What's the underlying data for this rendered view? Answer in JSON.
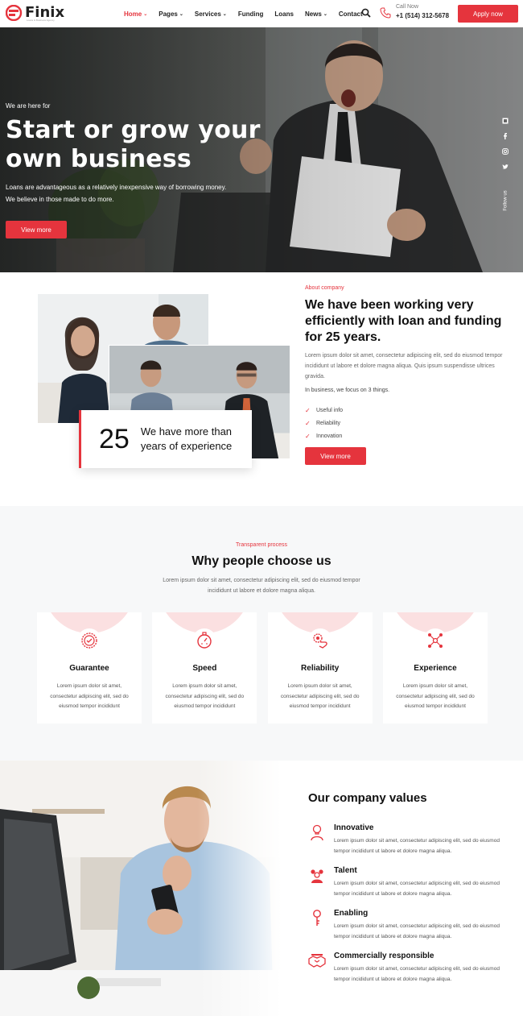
{
  "colors": {
    "accent": "#e5343d",
    "accent_soft": "#fbe0e1",
    "dark_text": "#111111",
    "muted_text": "#666666"
  },
  "header": {
    "logo_text": "Finix",
    "logo_tagline": "Loans & Business Agency",
    "nav": [
      {
        "label": "Home",
        "has_caret": true,
        "active": true
      },
      {
        "label": "Pages",
        "has_caret": true,
        "active": false
      },
      {
        "label": "Services",
        "has_caret": true,
        "active": false
      },
      {
        "label": "Funding",
        "has_caret": false,
        "active": false
      },
      {
        "label": "Loans",
        "has_caret": false,
        "active": false
      },
      {
        "label": "News",
        "has_caret": true,
        "active": false
      },
      {
        "label": "Contact",
        "has_caret": false,
        "active": false
      }
    ],
    "caret_glyph": "⌄",
    "search_icon": "search-icon",
    "call_label": "Call Now",
    "call_number": "+1 (514) 312-5678",
    "apply_label": "Apply now"
  },
  "hero": {
    "kicker": "We are here for",
    "title": "Start or grow your own business",
    "desc_line1": "Loans are advantageous as a relatively inexpensive way of borrowing money.",
    "desc_line2": "We believe in those made to do more.",
    "button": "View more",
    "follow_label": "Follow us",
    "social_icons": [
      "square-icon",
      "facebook-icon",
      "instagram-icon",
      "twitter-icon"
    ]
  },
  "about": {
    "kicker": "About company",
    "title": "We have been working very efficiently with loan and funding for 25 years.",
    "paragraph": "Lorem ipsum dolor sit amet, consectetur adipiscing elit, sed do eiusmod tempor incididunt ut labore et dolore magna aliqua. Quis ipsum suspendisse ultrices gravida.",
    "focus": "In business, we focus on 3 things.",
    "checks": [
      "Useful info",
      "Reliability",
      "Innovation"
    ],
    "check_glyph": "✓",
    "button": "View more",
    "exp_number": "25",
    "exp_text": "We have more than years of experience"
  },
  "why": {
    "kicker": "Transparent process",
    "title": "Why people choose us",
    "subtitle": "Lorem ipsum dolor sit amet, consectetur adipiscing elit, sed do eiusmod tempor incididunt ut labore et dolore magna aliqua.",
    "cards": [
      {
        "title": "Guarantee",
        "text": "Lorem ipsum dolor sit amet, consectetur adipiscing elit, sed do eiusmod tempor incididunt",
        "icon": "guarantee-badge-icon"
      },
      {
        "title": "Speed",
        "text": "Lorem ipsum dolor sit amet, consectetur adipiscing elit, sed do eiusmod tempor incididunt",
        "icon": "stopwatch-icon"
      },
      {
        "title": "Reliability",
        "text": "Lorem ipsum dolor sit amet, consectetur adipiscing elit, sed do eiusmod tempor incididunt",
        "icon": "handshake-gear-icon"
      },
      {
        "title": "Experience",
        "text": "Lorem ipsum dolor sit amet, consectetur adipiscing elit, sed do eiusmod tempor incididunt",
        "icon": "network-icon"
      }
    ]
  },
  "values": {
    "title": "Our company values",
    "items": [
      {
        "title": "Innovative",
        "text": "Lorem ipsum dolor sit amet, consectetur adipiscing elit, sed do eiusmod tempor incididunt ut labore et dolore magna aliqua.",
        "icon": "lightbulb-person-icon"
      },
      {
        "title": "Talent",
        "text": "Lorem ipsum dolor sit amet, consectetur adipiscing elit, sed do eiusmod tempor incididunt ut labore et dolore magna aliqua.",
        "icon": "team-icon"
      },
      {
        "title": "Enabling",
        "text": "Lorem ipsum dolor sit amet, consectetur adipiscing elit, sed do eiusmod tempor incididunt ut labore et dolore magna aliqua.",
        "icon": "key-icon"
      },
      {
        "title": "Commercially responsible",
        "text": "Lorem ipsum dolor sit amet, consectetur adipiscing elit, sed do eiusmod tempor incididunt ut labore et dolore magna aliqua.",
        "icon": "handshake-icon"
      }
    ]
  }
}
